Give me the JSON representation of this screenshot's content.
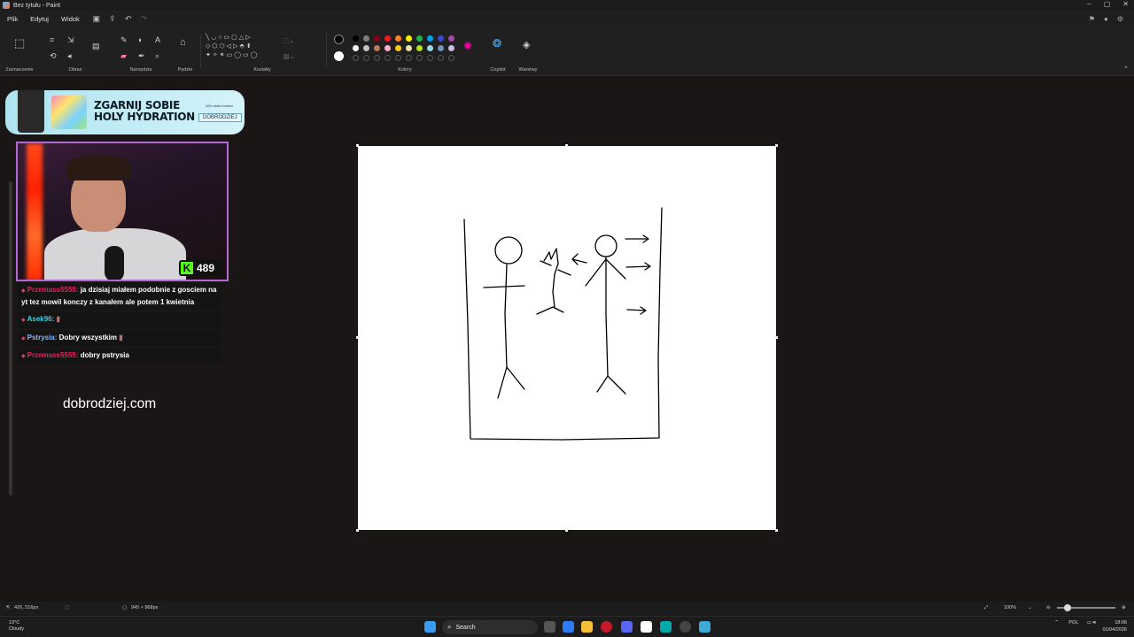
{
  "window": {
    "title": "Bez tytułu - Paint"
  },
  "menu": {
    "items": [
      "Plik",
      "Edytuj",
      "Widok"
    ]
  },
  "ribbon": {
    "groups": [
      "Zaznaczenie",
      "Obraz",
      "Narzędzia",
      "Pędzle",
      "Kształty",
      "Kolory",
      "Copilot",
      "Warstwy"
    ]
  },
  "colors": {
    "row1": [
      "#000000",
      "#7f7f7f",
      "#880015",
      "#ed1c24",
      "#ff7f27",
      "#fff200",
      "#22b14c",
      "#00a2e8",
      "#3f48cc",
      "#a349a4"
    ],
    "row2": [
      "#ffffff",
      "#c3c3c3",
      "#b97a57",
      "#ffaec9",
      "#ffc90e",
      "#efe4b0",
      "#b5e61d",
      "#99d9ea",
      "#7092be",
      "#c8bfe7"
    ]
  },
  "promo": {
    "line1": "ZGARNIJ SOBIE",
    "line2": "HOLY HYDRATION",
    "tiny": "10% zniżki z kodem",
    "code": "DOBRODZIEJ"
  },
  "stream": {
    "viewer_count": "489",
    "website": "dobrodziej.com"
  },
  "chat": [
    {
      "user": "Przemass5555:",
      "color": "#e0245e",
      "text": "ja dzisiaj miałem podobnie z gosciem na yt tez mowil konczy z kanałem ale potem 1 kwietnia"
    },
    {
      "user": "Asek96:",
      "color": "#3fd0e0",
      "text": ""
    },
    {
      "user": "Pstrysia:",
      "color": "#8ab4ff",
      "text": "Dobry wszystkim"
    },
    {
      "user": "Przemass5555:",
      "color": "#e0245e",
      "text": "dobry pstrysia"
    }
  ],
  "status": {
    "cursor_pos": "426, 516px",
    "canvas_size": "945 × 868px",
    "zoom": "100%"
  },
  "taskbar": {
    "search_label": "Search",
    "weather_temp": "13°C",
    "weather_desc": "Cloudy",
    "lang": "POL",
    "time": "18:06",
    "date": "01/04/2026"
  }
}
